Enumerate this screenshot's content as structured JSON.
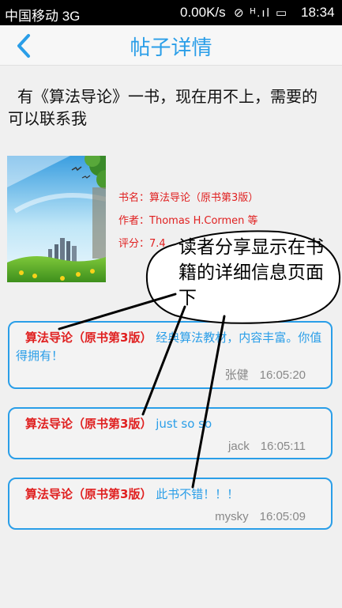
{
  "status_bar": {
    "carrier": "中国移动 3G",
    "speed": "0.00K/s",
    "icons": "⊘ ᴴ.ıl ▭",
    "time": "18:34"
  },
  "nav": {
    "back_icon": "‹",
    "title": "帖子详情"
  },
  "post": {
    "body": "有《算法导论》一书，现在用不上，需要的可以联系我"
  },
  "book": {
    "name_label": "书名：",
    "name": "算法导论（原书第3版）",
    "author_label": "作者：",
    "author": "Thomas H.Cormen 等",
    "rating_label": "评分：",
    "rating": "7.4"
  },
  "annotation": {
    "text": "读者分享显示在书籍的详细信息页面下"
  },
  "comments": [
    {
      "book_title": "算法导论（原书第3版）",
      "text": "经典算法教材，内容丰富。你值得拥有！",
      "author": "张健",
      "time": "16:05:20"
    },
    {
      "book_title": "算法导论（原书第3版）",
      "text": "just so so",
      "author": "jack",
      "time": "16:05:11"
    },
    {
      "book_title": "算法导论（原书第3版）",
      "text": "此书不错！！！",
      "author": "mysky",
      "time": "16:05:09"
    }
  ]
}
